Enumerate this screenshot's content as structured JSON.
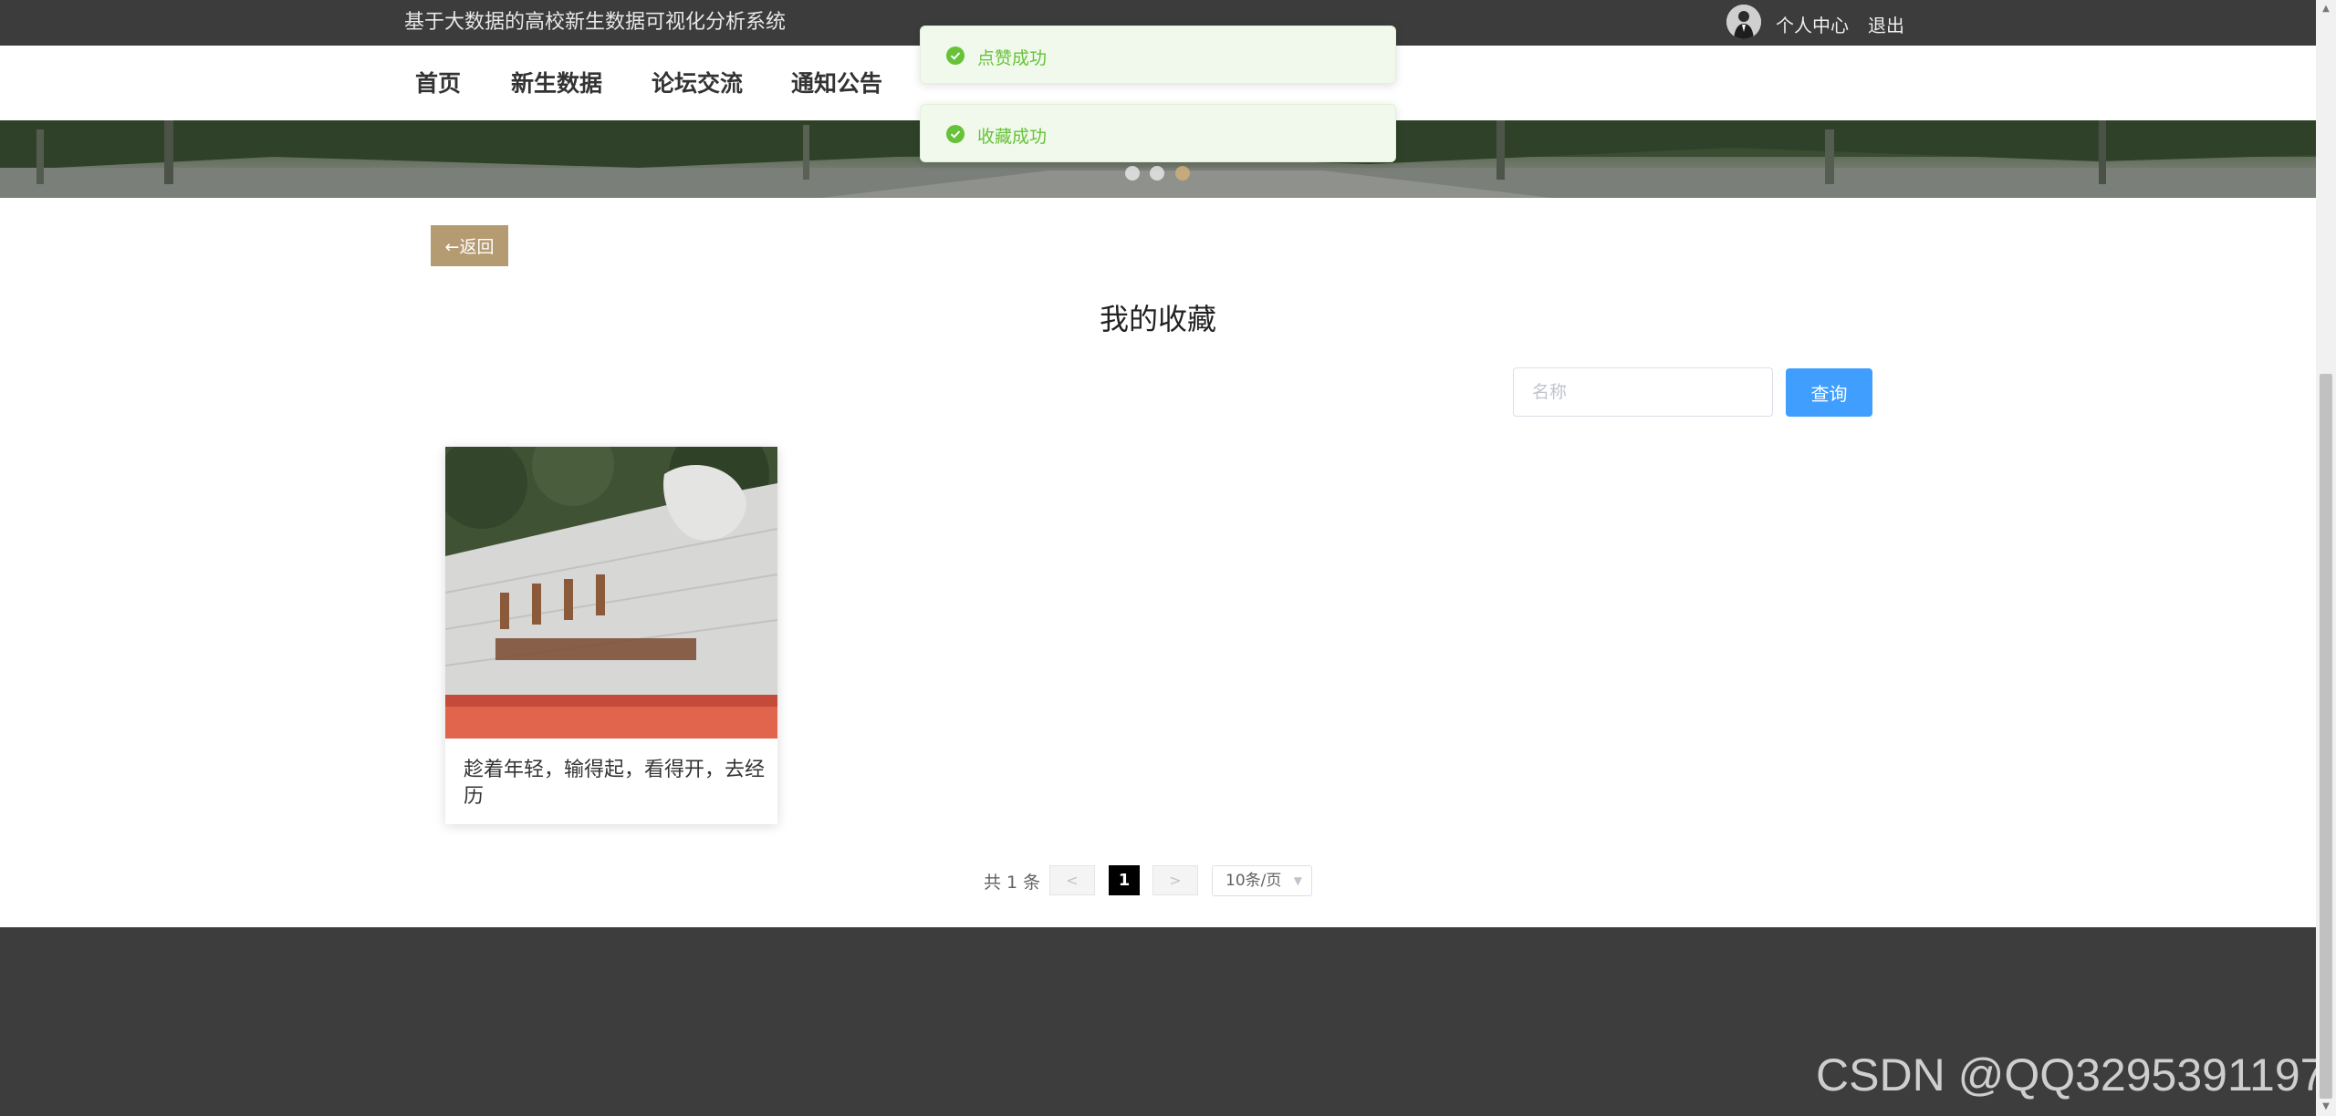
{
  "header": {
    "site_title": "基于大数据的高校新生数据可视化分析系统",
    "user_center": "个人中心",
    "logout": "退出"
  },
  "nav": {
    "items": [
      {
        "label": "首页"
      },
      {
        "label": "新生数据"
      },
      {
        "label": "论坛交流"
      },
      {
        "label": "通知公告"
      }
    ]
  },
  "toasts": [
    {
      "message": "点赞成功"
    },
    {
      "message": "收藏成功"
    }
  ],
  "banner": {
    "dots": 3,
    "active_dot": 3
  },
  "content": {
    "back_label": "←返回",
    "title": "我的收藏",
    "search": {
      "placeholder": "名称",
      "value": ""
    },
    "query_label": "查询",
    "cards": [
      {
        "text": "趁着年轻，输得起，看得开，去经历"
      }
    ]
  },
  "pagination": {
    "total": "共 1 条",
    "prev": "<",
    "current": "1",
    "next": ">",
    "page_size": "10条/页"
  },
  "watermark": "CSDN @QQ3295391197",
  "colors": {
    "topbar": "#3c3c3c",
    "accent": "#b59b72",
    "primary": "#409eff",
    "success": "#67c23a",
    "footer": "#3d3d3d"
  }
}
